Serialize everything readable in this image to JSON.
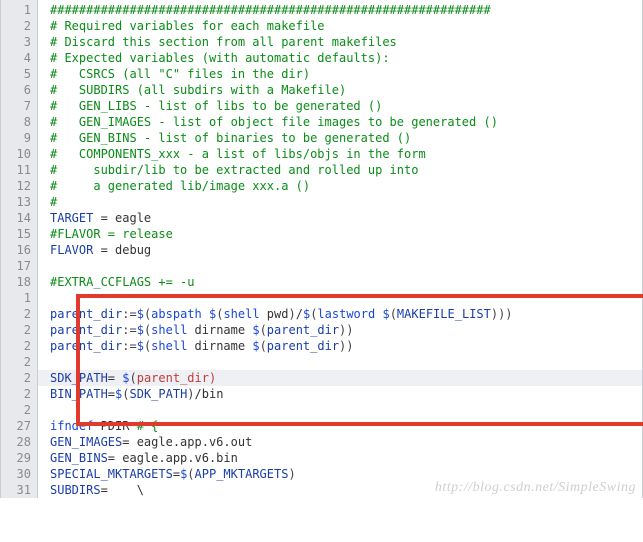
{
  "watermark": "http://blog.csdn.net/SimpleSwing",
  "gutter": [
    "1",
    "2",
    "3",
    "4",
    "5",
    "6",
    "7",
    "8",
    "9",
    "10",
    "11",
    "12",
    "13",
    "14",
    "15",
    "16",
    "17",
    "18",
    "1",
    "2",
    "2",
    "2",
    "2",
    "2",
    "2",
    "2",
    "27",
    "28",
    "29",
    "30",
    "31"
  ],
  "lines": [
    [
      {
        "c": "tok-comment",
        "t": "#############################################################"
      }
    ],
    [
      {
        "c": "tok-comment",
        "t": "# Required variables for each makefile"
      }
    ],
    [
      {
        "c": "tok-comment",
        "t": "# Discard this section from all parent makefiles"
      }
    ],
    [
      {
        "c": "tok-comment",
        "t": "# Expected variables (with automatic defaults):"
      }
    ],
    [
      {
        "c": "tok-comment",
        "t": "#   CSRCS (all \"C\" files in the dir)"
      }
    ],
    [
      {
        "c": "tok-comment",
        "t": "#   SUBDIRS (all subdirs with a Makefile)"
      }
    ],
    [
      {
        "c": "tok-comment",
        "t": "#   GEN_LIBS - list of libs to be generated ()"
      }
    ],
    [
      {
        "c": "tok-comment",
        "t": "#   GEN_IMAGES - list of object file images to be generated ()"
      }
    ],
    [
      {
        "c": "tok-comment",
        "t": "#   GEN_BINS - list of binaries to be generated ()"
      }
    ],
    [
      {
        "c": "tok-comment",
        "t": "#   COMPONENTS_xxx - a list of libs/objs in the form"
      }
    ],
    [
      {
        "c": "tok-comment",
        "t": "#     subdir/lib to be extracted and rolled up into"
      }
    ],
    [
      {
        "c": "tok-comment",
        "t": "#     a generated lib/image xxx.a ()"
      }
    ],
    [
      {
        "c": "tok-comment",
        "t": "#"
      }
    ],
    [
      {
        "c": "tok-var",
        "t": "TARGET"
      },
      {
        "c": "tok-plain",
        "t": " = eagle"
      }
    ],
    [
      {
        "c": "tok-comment",
        "t": "#FLAVOR = release"
      }
    ],
    [
      {
        "c": "tok-var",
        "t": "FLAVOR"
      },
      {
        "c": "tok-plain",
        "t": " = debug"
      }
    ],
    [
      {
        "c": "tok-plain",
        "t": ""
      }
    ],
    [
      {
        "c": "tok-comment",
        "t": "#EXTRA_CCFLAGS += -u"
      }
    ],
    [
      {
        "c": "tok-plain",
        "t": ""
      }
    ],
    [
      {
        "c": "tok-var",
        "t": "parent_dir"
      },
      {
        "c": "tok-punc",
        "t": ":="
      },
      {
        "c": "tok-kw",
        "t": "$"
      },
      {
        "c": "tok-punc",
        "t": "("
      },
      {
        "c": "tok-func",
        "t": "abspath"
      },
      {
        "c": "tok-plain",
        "t": " "
      },
      {
        "c": "tok-kw",
        "t": "$"
      },
      {
        "c": "tok-punc",
        "t": "("
      },
      {
        "c": "tok-func",
        "t": "shell"
      },
      {
        "c": "tok-plain",
        "t": " pwd"
      },
      {
        "c": "tok-punc",
        "t": ")"
      },
      {
        "c": "tok-plain",
        "t": "/"
      },
      {
        "c": "tok-kw",
        "t": "$"
      },
      {
        "c": "tok-punc",
        "t": "("
      },
      {
        "c": "tok-func",
        "t": "lastword"
      },
      {
        "c": "tok-plain",
        "t": " "
      },
      {
        "c": "tok-kw",
        "t": "$"
      },
      {
        "c": "tok-punc",
        "t": "("
      },
      {
        "c": "tok-var",
        "t": "MAKEFILE_LIST"
      },
      {
        "c": "tok-punc",
        "t": ")))"
      }
    ],
    [
      {
        "c": "tok-var",
        "t": "parent_dir"
      },
      {
        "c": "tok-punc",
        "t": ":="
      },
      {
        "c": "tok-kw",
        "t": "$"
      },
      {
        "c": "tok-punc",
        "t": "("
      },
      {
        "c": "tok-func",
        "t": "shell"
      },
      {
        "c": "tok-plain",
        "t": " dirname "
      },
      {
        "c": "tok-kw",
        "t": "$"
      },
      {
        "c": "tok-punc",
        "t": "("
      },
      {
        "c": "tok-var",
        "t": "parent_dir"
      },
      {
        "c": "tok-punc",
        "t": "))"
      }
    ],
    [
      {
        "c": "tok-var",
        "t": "parent_dir"
      },
      {
        "c": "tok-punc",
        "t": ":="
      },
      {
        "c": "tok-kw",
        "t": "$"
      },
      {
        "c": "tok-punc",
        "t": "("
      },
      {
        "c": "tok-func",
        "t": "shell"
      },
      {
        "c": "tok-plain",
        "t": " dirname "
      },
      {
        "c": "tok-kw",
        "t": "$"
      },
      {
        "c": "tok-punc",
        "t": "("
      },
      {
        "c": "tok-var",
        "t": "parent_dir"
      },
      {
        "c": "tok-punc",
        "t": "))"
      }
    ],
    [
      {
        "c": "tok-plain",
        "t": ""
      }
    ],
    [
      {
        "c": "tok-var",
        "t": "SDK_PATH"
      },
      {
        "c": "tok-plain",
        "t": "= "
      },
      {
        "c": "tok-kw",
        "t": "$"
      },
      {
        "c": "tok-punc",
        "t": "("
      },
      {
        "c": "tok-red",
        "t": "parent_dir"
      },
      {
        "c": "tok-red",
        "t": ")"
      }
    ],
    [
      {
        "c": "tok-var",
        "t": "BIN_PATH"
      },
      {
        "c": "tok-plain",
        "t": "="
      },
      {
        "c": "tok-kw",
        "t": "$"
      },
      {
        "c": "tok-punc",
        "t": "("
      },
      {
        "c": "tok-var",
        "t": "SDK_PATH"
      },
      {
        "c": "tok-punc",
        "t": ")"
      },
      {
        "c": "tok-plain",
        "t": "/bin"
      }
    ],
    [
      {
        "c": "tok-plain",
        "t": ""
      }
    ],
    [
      {
        "c": "tok-kw",
        "t": "ifndef"
      },
      {
        "c": "tok-plain",
        "t": " PDIR "
      },
      {
        "c": "tok-comment",
        "t": "# {"
      }
    ],
    [
      {
        "c": "tok-var",
        "t": "GEN_IMAGES"
      },
      {
        "c": "tok-plain",
        "t": "= eagle.app.v6.out"
      }
    ],
    [
      {
        "c": "tok-var",
        "t": "GEN_BINS"
      },
      {
        "c": "tok-plain",
        "t": "= eagle.app.v6.bin"
      }
    ],
    [
      {
        "c": "tok-var",
        "t": "SPECIAL_MKTARGETS"
      },
      {
        "c": "tok-plain",
        "t": "="
      },
      {
        "c": "tok-kw",
        "t": "$"
      },
      {
        "c": "tok-punc",
        "t": "("
      },
      {
        "c": "tok-var",
        "t": "APP_MKTARGETS"
      },
      {
        "c": "tok-punc",
        "t": ")"
      }
    ],
    [
      {
        "c": "tok-var",
        "t": "SUBDIRS"
      },
      {
        "c": "tok-plain",
        "t": "=    \\"
      }
    ]
  ],
  "currentLineIndex": 23
}
